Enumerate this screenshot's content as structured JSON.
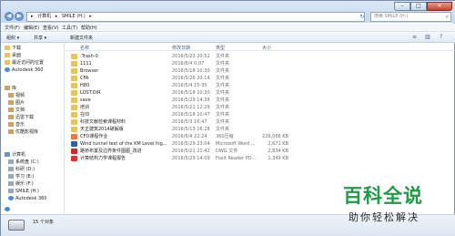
{
  "window": {
    "controls": {
      "minimize": "–",
      "maximize": "□",
      "close": "✕"
    }
  },
  "address": {
    "segments": [
      "▸",
      "计算机",
      "▸",
      "SMILE (H:)",
      "▸"
    ],
    "refresh": "↻"
  },
  "search": {
    "placeholder": "搜索 SMILE (H:)",
    "icon": "search-icon"
  },
  "menubar": {
    "items": [
      "文件(F)",
      "编辑(E)",
      "查看(V)",
      "工具(T)",
      "帮助(H)"
    ]
  },
  "toolbar": {
    "organize": "组织 ▾",
    "share": "共享 ▾",
    "new_folder": "新建文件夹",
    "view_icon": "≡",
    "pane_icon": "▥",
    "help_icon": "?"
  },
  "sidebar": {
    "favorites": [
      "下载",
      "桌面",
      "最近访问的位置",
      "Autodesk 360"
    ],
    "libraries_title": "库",
    "libraries": [
      "视频",
      "图片",
      "文档",
      "迅雷下载",
      "音乐",
      "优酷影视库"
    ],
    "computer_title": "计算机",
    "drives": [
      "系统盘 (C:)",
      "科研 (D:)",
      "学习 (E:)",
      "娱乐 (F:)",
      "SMILE (H:)",
      "Autodesk 360"
    ]
  },
  "columns": {
    "name": "名称",
    "date": "修改日期",
    "type": "类型",
    "size": "大小"
  },
  "files": [
    {
      "icon": "folder",
      "name": ".Trash-0",
      "date": "2016/5/23 20:52",
      "type": "文件夹",
      "size": ""
    },
    {
      "icon": "folder",
      "name": "1111",
      "date": "2016/6/4 0:07",
      "type": "文件夹",
      "size": ""
    },
    {
      "icon": "folder",
      "name": "Browser",
      "date": "2016/5/18 10:30",
      "type": "文件夹",
      "size": ""
    },
    {
      "icon": "folder",
      "name": "CFA",
      "date": "2016/5/26 20:14",
      "type": "文件夹",
      "size": ""
    },
    {
      "icon": "folder",
      "name": "H80",
      "date": "2016/5/4 15:35",
      "type": "文件夹",
      "size": ""
    },
    {
      "icon": "folder",
      "name": "LOST.DIR",
      "date": "2016/5/18 10:30",
      "type": "文件夹",
      "size": ""
    },
    {
      "icon": "folder",
      "name": "save",
      "date": "2016/5/29 14:38",
      "type": "文件夹",
      "size": ""
    },
    {
      "icon": "folder",
      "name": "培训",
      "date": "2016/5/21 12:29",
      "type": "文件夹",
      "size": ""
    },
    {
      "icon": "folder",
      "name": "在ID",
      "date": "2016/5/18 10:47",
      "type": "文件夹",
      "size": ""
    },
    {
      "icon": "folder",
      "name": "科技文献检索课程材料",
      "date": "2016/5/3 16:47",
      "type": "文件夹",
      "size": ""
    },
    {
      "icon": "folder",
      "name": "天正建筑2014破解版",
      "date": "2016/5/13 16:28",
      "type": "文件夹",
      "size": ""
    },
    {
      "icon": "cfd",
      "name": "CFD课程作业",
      "date": "2016/6/4 22:24",
      "type": "360压缩",
      "size": "226,066 KB"
    },
    {
      "icon": "word",
      "name": "Wind tunnel test of the KM Level hig...",
      "date": "2016/5/29 23:04",
      "type": "Microsoft Word ...",
      "size": "2,671 KB"
    },
    {
      "icon": "dwg",
      "name": "路桥布置及边界条件图图_改进",
      "date": "2016/5/21 21:42",
      "type": "DWG 文件",
      "size": "2,834 KB"
    },
    {
      "icon": "pdf",
      "name": "计算结构力学课程报告",
      "date": "2016/5/29 14:09",
      "type": "Foxit Reader PD...",
      "size": "1,349 KB"
    }
  ],
  "status": {
    "count": "15 个对象"
  },
  "watermark": {
    "title": "百科全说",
    "subtitle": "助你轻松解决"
  }
}
